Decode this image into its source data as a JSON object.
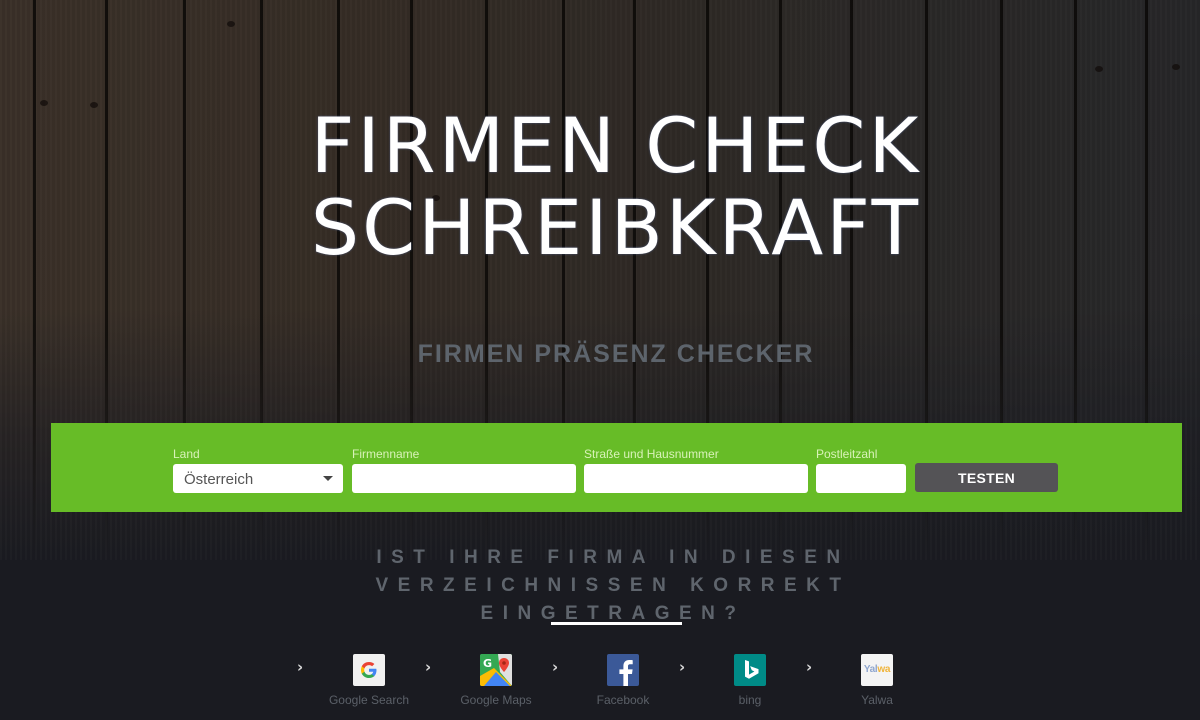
{
  "hero": {
    "title_line1": "FIRMEN CHECK",
    "title_line2": "SCHREIBKRAFT",
    "subtitle": "FIRMEN PRÄSENZ CHECKER"
  },
  "form": {
    "fields": [
      {
        "label": "Land",
        "type": "select",
        "value": "Österreich"
      },
      {
        "label": "Firmenname",
        "type": "text",
        "value": "",
        "placeholder": ""
      },
      {
        "label": "Straße und Hausnummer",
        "type": "text",
        "value": "",
        "placeholder": ""
      },
      {
        "label": "Postleitzahl",
        "type": "text",
        "value": "",
        "placeholder": ""
      }
    ],
    "submit_label": "TESTEN"
  },
  "question": {
    "line1": "IST IHRE FIRMA IN DIESEN",
    "line2": "VERZEICHNISSEN KORREKT",
    "line3": "EINGETRAGEN?"
  },
  "directories": [
    {
      "label": "Google Search",
      "icon": "google-icon"
    },
    {
      "label": "Google Maps",
      "icon": "google-maps-icon"
    },
    {
      "label": "Facebook",
      "icon": "facebook-icon"
    },
    {
      "label": "bing",
      "icon": "bing-icon"
    },
    {
      "label": "Yalwa",
      "icon": "yalwa-icon",
      "icon_text_a": "Yal",
      "icon_text_b": "wa"
    }
  ],
  "colors": {
    "accent_green": "#67bc27",
    "button_gray": "#545356",
    "page_dark": "#1a1b21",
    "muted_text": "#5f656d"
  }
}
